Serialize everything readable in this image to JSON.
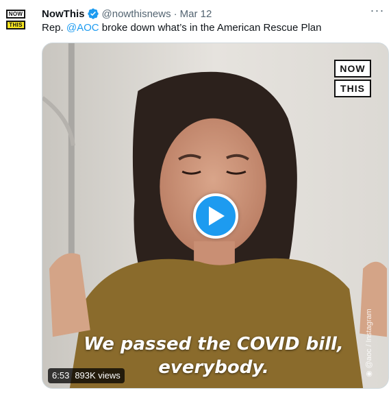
{
  "author": {
    "avatar_logo": [
      "NOW",
      "THIS"
    ],
    "display_name": "NowThis",
    "verified_icon": "verified-badge-icon",
    "handle": "@nowthisnews",
    "separator": "·",
    "date": "Mar 12"
  },
  "more_menu_icon": "more-options-icon",
  "tweet": {
    "text_prefix": "Rep. ",
    "mention": "@AOC",
    "text_suffix": " broke down what’s in the American Rescue Plan"
  },
  "media": {
    "watermark": [
      "NOW",
      "THIS"
    ],
    "play_icon": "play-icon",
    "caption_lines": [
      "We passed the COVID bill,",
      "everybody."
    ],
    "credit": "◉ @aoc / Instagram",
    "duration": "6:53",
    "views": "893K views"
  },
  "colors": {
    "accent": "#1d9bf0",
    "text_primary": "#0f1419",
    "text_secondary": "#536471",
    "logo_yellow": "#f7e51f"
  }
}
